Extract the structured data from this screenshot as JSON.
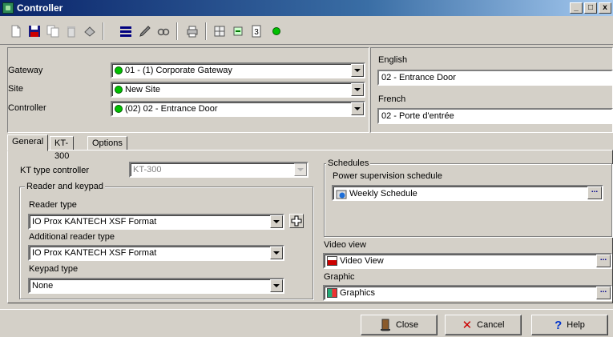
{
  "window": {
    "title": "Controller"
  },
  "titlebar_buttons": {
    "minimize": "_",
    "maximize": "□",
    "close": "x"
  },
  "toolbar": {
    "items": [
      {
        "name": "new-icon"
      },
      {
        "name": "save-icon"
      },
      {
        "name": "copy-icon"
      },
      {
        "name": "delete-icon"
      },
      {
        "name": "print-icon"
      },
      {
        "name": "list-icon"
      },
      {
        "name": "edit-icon"
      },
      {
        "name": "find-icon"
      },
      {
        "name": "printer-icon"
      },
      {
        "name": "grid-icon"
      },
      {
        "name": "link-icon"
      },
      {
        "name": "help-icon"
      },
      {
        "name": "status-green-icon"
      }
    ]
  },
  "form": {
    "gateway_label": "Gateway",
    "gateway_value": "01 - (1) Corporate Gateway",
    "site_label": "Site",
    "site_value": "New Site",
    "controller_label": "Controller",
    "controller_value": "(02) 02 - Entrance Door"
  },
  "languages": {
    "english_label": "English",
    "english_value": "02 - Entrance Door",
    "french_label": "French",
    "french_value": "02 - Porte d'entrée"
  },
  "tabs": [
    {
      "label": "General",
      "active": true
    },
    {
      "label": "KT-300",
      "active": false
    },
    {
      "label": "Options",
      "active": false
    }
  ],
  "general": {
    "kt_type_label": "KT type controller",
    "kt_type_value": "KT-300",
    "reader_group_title": "Reader and keypad",
    "reader_type_label": "Reader type",
    "reader_type_value": "IO Prox KANTECH XSF Format",
    "add_reader_label": "Additional reader type",
    "add_reader_value": "IO Prox KANTECH XSF Format",
    "keypad_label": "Keypad type",
    "keypad_value": "None",
    "schedules_title": "Schedules",
    "power_label": "Power supervision schedule",
    "power_value": "Weekly Schedule",
    "video_label": "Video view",
    "video_value": "Video View",
    "graphic_label": "Graphic",
    "graphic_value": "Graphics",
    "browse_label": "..."
  },
  "buttons": {
    "close": "Close",
    "cancel": "Cancel",
    "help": "Help"
  },
  "colors": {
    "status_green": "#00c000",
    "cancel_x": "#cc0000",
    "help_q": "#0033cc"
  }
}
